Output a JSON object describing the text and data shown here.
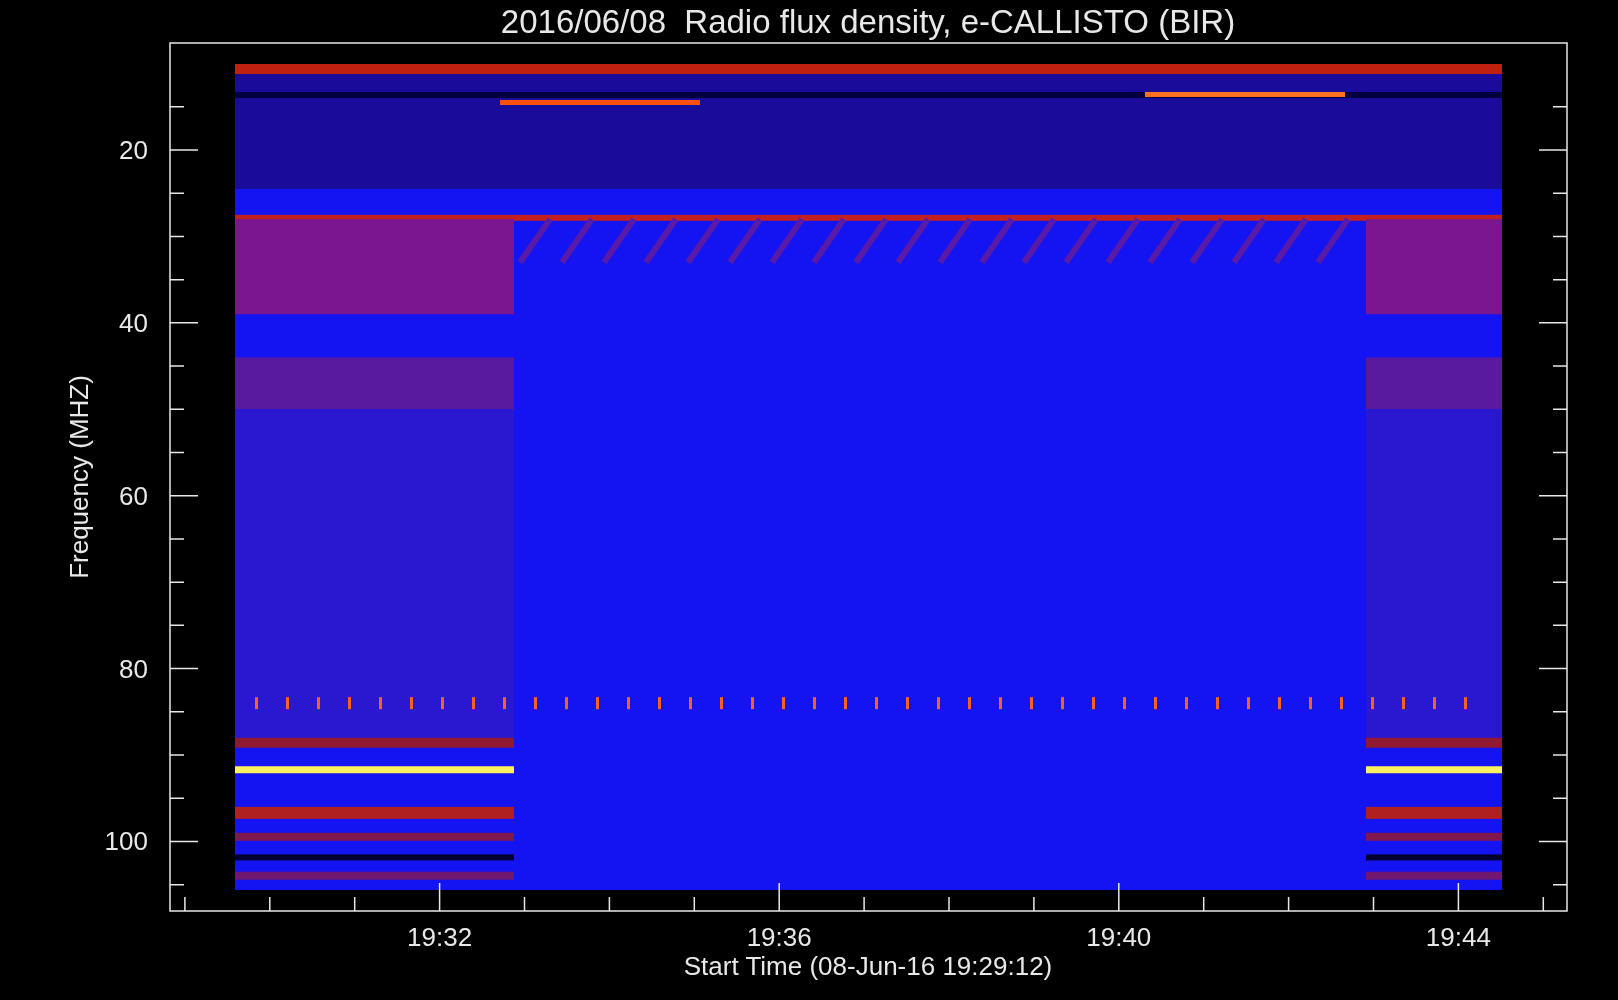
{
  "title": "2016/06/08  Radio flux density, e-CALLISTO (BIR)",
  "y_axis": {
    "label": "Frequency (MHZ)",
    "ticks": [
      "20",
      "40",
      "60",
      "80",
      "100"
    ]
  },
  "x_axis": {
    "label": "Start Time (08-Jun-16 19:29:12)",
    "ticks": [
      "19:32",
      "19:36",
      "19:40",
      "19:44"
    ]
  }
}
